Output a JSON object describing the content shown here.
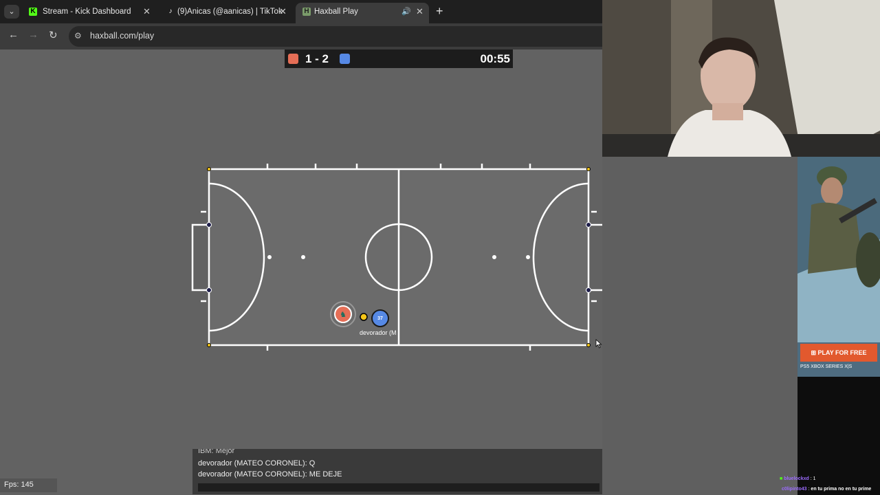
{
  "browser": {
    "tabs": [
      {
        "title": "Stream - Kick Dashboard",
        "favicon": "kick-logo-icon",
        "active": false
      },
      {
        "title": "(9)Anicas (@aanicas) | TikTok",
        "favicon": "tiktok-logo-icon",
        "active": false
      },
      {
        "title": "Haxball Play",
        "favicon": "haxball-logo-icon",
        "active": true
      }
    ],
    "url": "haxball.com/play"
  },
  "scoreboard": {
    "score": "1 - 2",
    "time": "00:55",
    "red_color": "#e56e56",
    "blue_color": "#5689e5"
  },
  "field": {
    "player_red_avatar": "horse-icon",
    "player_blue_number": "37",
    "player_blue_name": "devorador (M",
    "ball_color": "#f5c518"
  },
  "chat": {
    "partial_line": "IBM: Mejor",
    "messages": [
      "devorador (MATEO CORONEL): Q",
      "devorador (MATEO CORONEL): ME DEJE"
    ]
  },
  "fps": "Fps: 145",
  "ad": {
    "button_label": "PLAY FOR FREE",
    "platforms": "PS5   XBOX SERIES X|S"
  },
  "stream_chat": [
    {
      "user": "bluelockxd",
      "message": "1"
    },
    {
      "user": "c0lipinto43",
      "message": "en tu prima no en tu prime"
    }
  ]
}
